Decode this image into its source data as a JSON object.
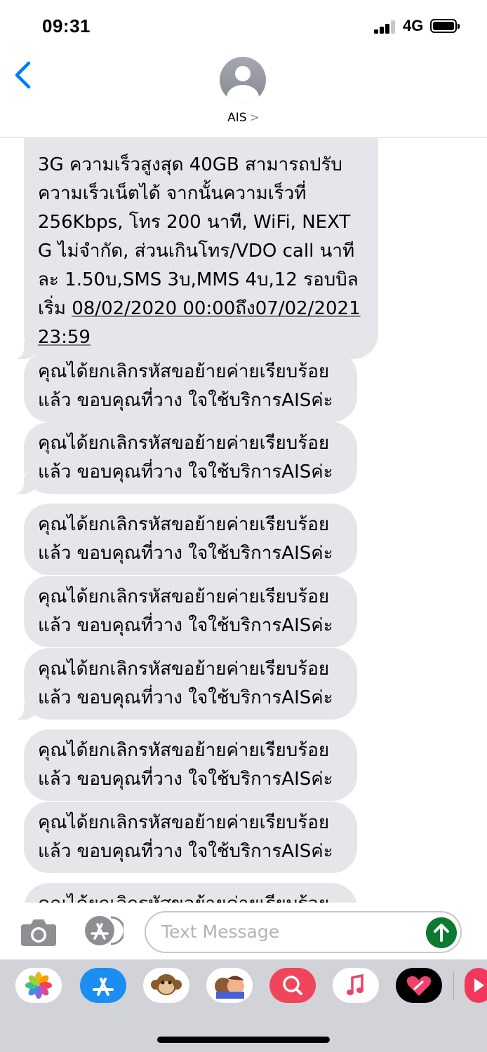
{
  "status": {
    "time": "09:31",
    "network": "4G"
  },
  "header": {
    "contact_name": "AIS",
    "chevron": ">"
  },
  "first_message": {
    "lines": [
      "3G ความเร็วสูงสุด 40GB สามารถปรับ",
      "ความเร็วเน็ตได้ จากนั้นความเร็วที่",
      "256Kbps, โทร 200 นาที, WiFi, NEXT",
      "G ไม่จำกัด, ส่วนเกินโทร/VDO call นาที",
      "ละ 1.50บ,SMS 3บ,MMS 4บ,12 รอบบิล"
    ],
    "line6_prefix": "เริ่ม ",
    "line6_link": "08/02/2020 00:00ถึง07/02/2021",
    "line7_link": "23:59"
  },
  "repeated_message": {
    "line1": "คุณได้ยกเลิกรหัสขอย้ายค่ายเรียบร้อย",
    "line2": "แล้ว ขอบคุณที่วาง ใจใช้บริการAISค่ะ"
  },
  "input": {
    "placeholder": "Text Message"
  },
  "app_drawer": {
    "apps": [
      "photos-app",
      "app-store-app",
      "animoji-app",
      "memoji-app",
      "web-search-app",
      "music-app",
      "digital-touch-app",
      "more-app"
    ]
  },
  "colors": {
    "bubble": "#e5e5ea",
    "ios_blue": "#007aff",
    "send_green": "#0c7a2f",
    "drawer": "#d1d3d9"
  }
}
